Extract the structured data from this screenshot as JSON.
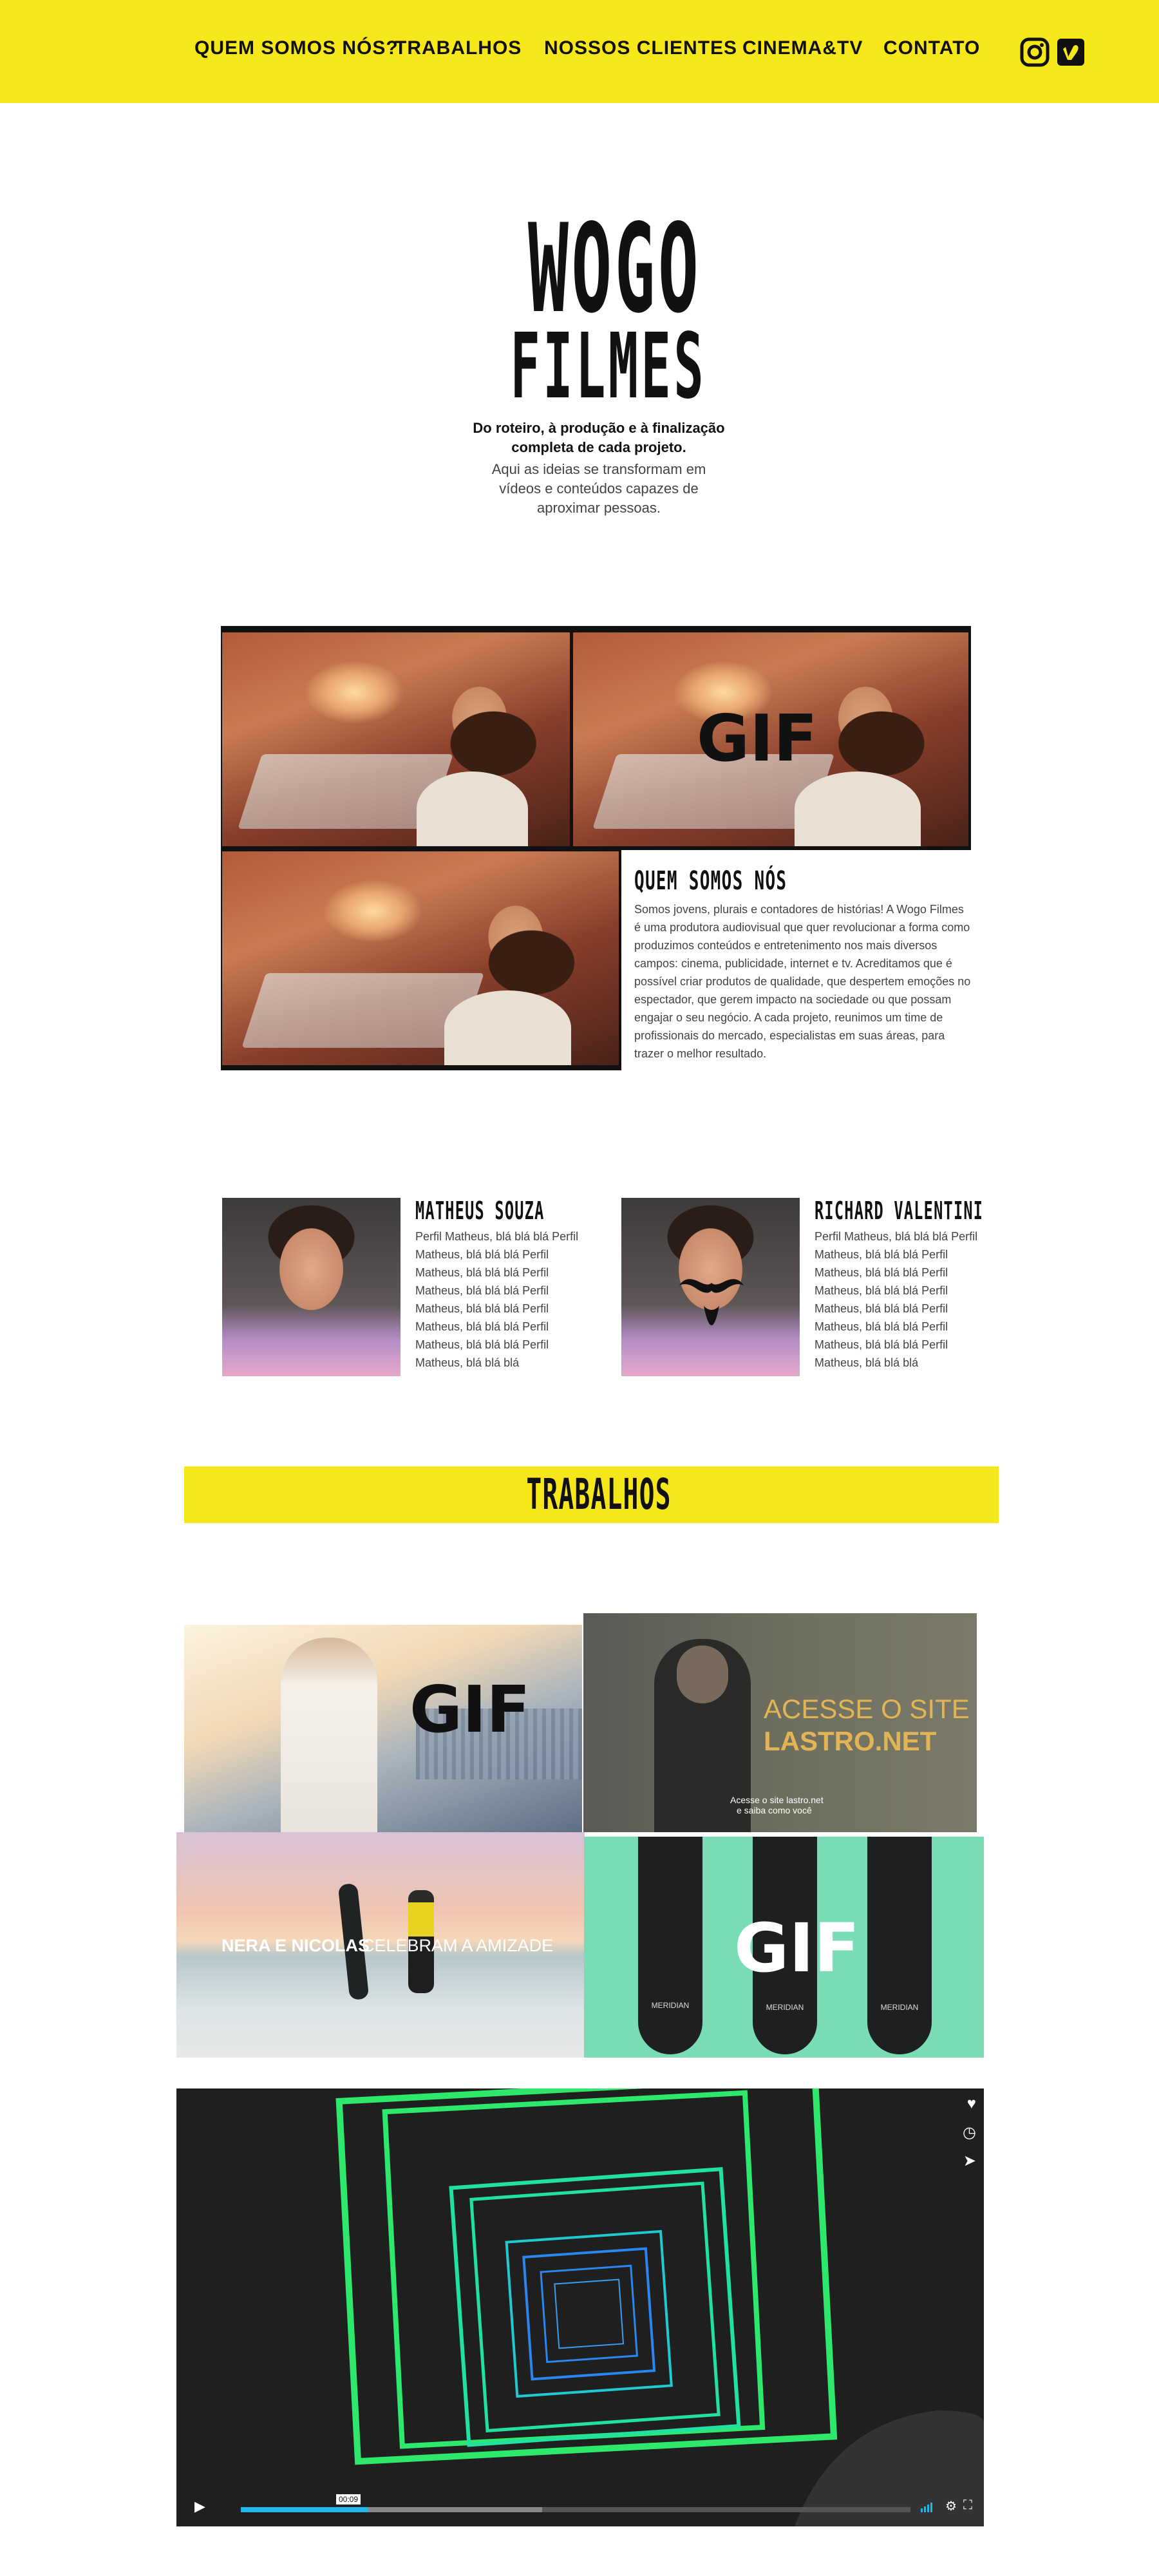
{
  "nav": {
    "links": [
      "QUEM SOMOS NÓS?",
      "TRABALHOS",
      "NOSSOS CLIENTES",
      "CINEMA&TV",
      "CONTATO"
    ],
    "icons": [
      "instagram-icon",
      "vimeo-icon"
    ],
    "background": "#f6e71a"
  },
  "logo": {
    "line1": "WOGO",
    "line2": "FILMES"
  },
  "hero": {
    "tagline_bold": "Do roteiro, à produção e à finalização completa de cada projeto.",
    "tagline": "Aqui as ideias se transformam em vídeos e conteúdos capazes de aproximar pessoas."
  },
  "gif_label": "GIF",
  "about": {
    "title": "QUEM SOMOS NÓS",
    "text": "Somos jovens, plurais e contadores de histórias! A Wogo Filmes é uma produtora audiovisual que quer revolucionar a forma como produzimos conteúdos e entretenimento nos mais diversos campos: cinema, publicidade, internet e tv. Acreditamos que é possível criar produtos de qualidade, que despertem emoções no espectador, que gerem impacto na sociedade ou que possam engajar o seu negócio. A cada projeto, reunimos um time de profissionais do mercado, especialistas em suas áreas, para trazer o melhor resultado."
  },
  "team": [
    {
      "name": "MATHEUS SOUZA",
      "bio": "Perfil Matheus, blá blá blá Perfil Matheus, blá blá blá Perfil Matheus, blá blá blá Perfil Matheus, blá blá blá Perfil Matheus, blá blá blá Perfil Matheus, blá blá blá Perfil Matheus, blá blá blá Perfil Matheus, blá blá blá"
    },
    {
      "name": "RICHARD VALENTINI",
      "bio": "Perfil Matheus, blá blá blá Perfil Matheus, blá blá blá Perfil Matheus, blá blá blá Perfil Matheus, blá blá blá Perfil Matheus, blá blá blá Perfil Matheus, blá blá blá Perfil Matheus, blá blá blá Perfil Matheus, blá blá blá"
    }
  ],
  "works": {
    "heading": "TRABALHOS",
    "lastro": {
      "line1": "ACESSE O SITE",
      "line2": "LASTRO.NET",
      "caption1": "Acesse o site lastro.net",
      "caption2": "e saiba como você"
    },
    "beach": {
      "strong": "NERA E NICOLAS",
      "rest": "CELEBRAM A AMIZADE"
    },
    "trimmer_brand": "MERIDIAN"
  },
  "video": {
    "time": "00:09",
    "progress": 0.19,
    "buffered": 0.45
  }
}
